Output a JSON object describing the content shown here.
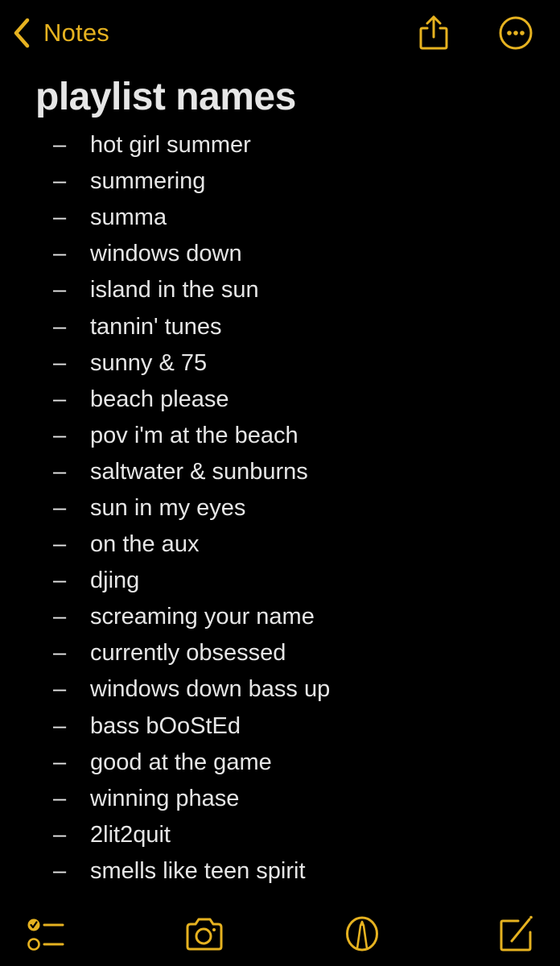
{
  "theme": {
    "accent": "#e6b220",
    "background": "#000000",
    "text": "#e6e6e6"
  },
  "nav": {
    "back_label": "Notes",
    "back_icon": "chevron-left-icon",
    "share_icon": "share-icon",
    "more_icon": "ellipsis-circle-icon"
  },
  "note": {
    "title": "playlist names",
    "bullet": "–",
    "items": [
      "hot girl summer",
      "summering",
      "summa",
      "windows down",
      "island in the sun",
      "tannin' tunes",
      "sunny & 75",
      "beach please",
      "pov i'm at the beach",
      "saltwater & sunburns",
      "sun in my eyes",
      "on the aux",
      "djing",
      "screaming your name",
      "currently obsessed",
      "windows down bass up",
      "bass bOoStEd",
      "good at the game",
      "winning phase",
      "2lit2quit",
      "smells like teen spirit"
    ]
  },
  "toolbar": {
    "icons": [
      "checklist-icon",
      "camera-icon",
      "markup-icon",
      "compose-icon"
    ]
  }
}
